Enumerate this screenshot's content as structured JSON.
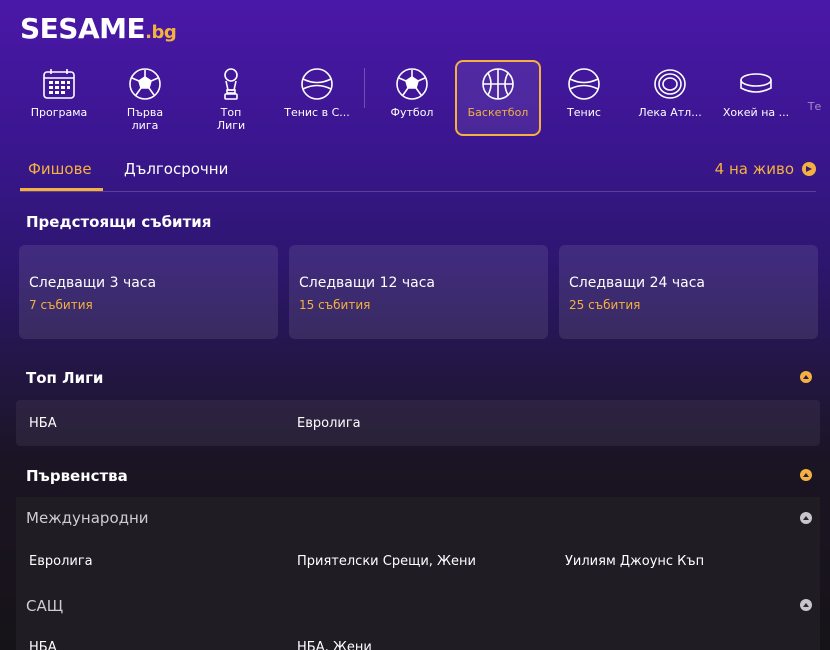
{
  "logo": {
    "name": "SESAME",
    "tld": ".bg"
  },
  "sports": [
    {
      "label": "Програма",
      "icon": "calendar-icon"
    },
    {
      "label": "Първа\nлига",
      "icon": "soccer-ball-icon"
    },
    {
      "label": "Топ\nЛиги",
      "icon": "trophy-icon"
    },
    {
      "label": "Тенис в С...",
      "icon": "tennis-ball-icon"
    },
    {
      "label": "Футбол",
      "icon": "soccer-ball-icon"
    },
    {
      "label": "Баскетбол",
      "icon": "basketball-icon",
      "active": true
    },
    {
      "label": "Тенис",
      "icon": "tennis-ball-icon"
    },
    {
      "label": "Лека Атл...",
      "icon": "running-track-icon"
    },
    {
      "label": "Хокей на ...",
      "icon": "hockey-puck-icon"
    },
    {
      "label": "Те",
      "icon": ""
    }
  ],
  "tabs": {
    "tickets": "Фишове",
    "longterm": "Дългосрочни",
    "live": "4 на живо"
  },
  "upcoming": {
    "title": "Предстоящи събития",
    "cards": [
      {
        "title": "Следващи 3 часа",
        "count": "7 събития"
      },
      {
        "title": "Следващи 12 часа",
        "count": "15 събития"
      },
      {
        "title": "Следващи 24 часа",
        "count": "25 събития"
      }
    ]
  },
  "top_leagues": {
    "title": "Топ Лиги",
    "items": [
      "НБА",
      "Евролига"
    ]
  },
  "championships": {
    "title": "Първенства",
    "groups": [
      {
        "name": "Международни",
        "items": [
          "Евролига",
          "Приятелски Срещи, Жени",
          "Уилиям Джоунс Къп"
        ]
      },
      {
        "name": "САЩ",
        "items": [
          "НБА",
          "НБА, Жени"
        ]
      }
    ]
  },
  "colors": {
    "accent": "#f4b13f",
    "bg_top": "#4a18a8",
    "bg_bottom": "#161318"
  }
}
